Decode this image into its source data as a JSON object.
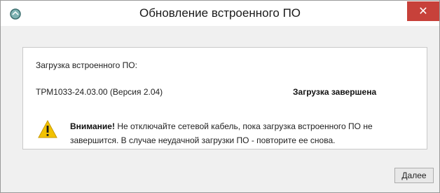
{
  "window": {
    "title": "Обновление встроенного ПО",
    "close_label": "✕"
  },
  "panel": {
    "heading": "Загрузка встроенного ПО:",
    "file_name": "ТРМ1033-24.03.00 (Версия 2.04)",
    "status": "Загрузка завершена"
  },
  "warning": {
    "label": "Внимание!",
    "text": "Не отключайте сетевой кабель, пока загрузка встроенного ПО не завершится. В случае неудачной загрузки ПО - повторите ее снова."
  },
  "buttons": {
    "next_label": "Далее"
  },
  "colors": {
    "close_button": "#c7413a",
    "warning_icon": "#f2c200"
  },
  "icons": {
    "app": "app-icon",
    "close": "close-icon",
    "warning": "warning-icon"
  }
}
